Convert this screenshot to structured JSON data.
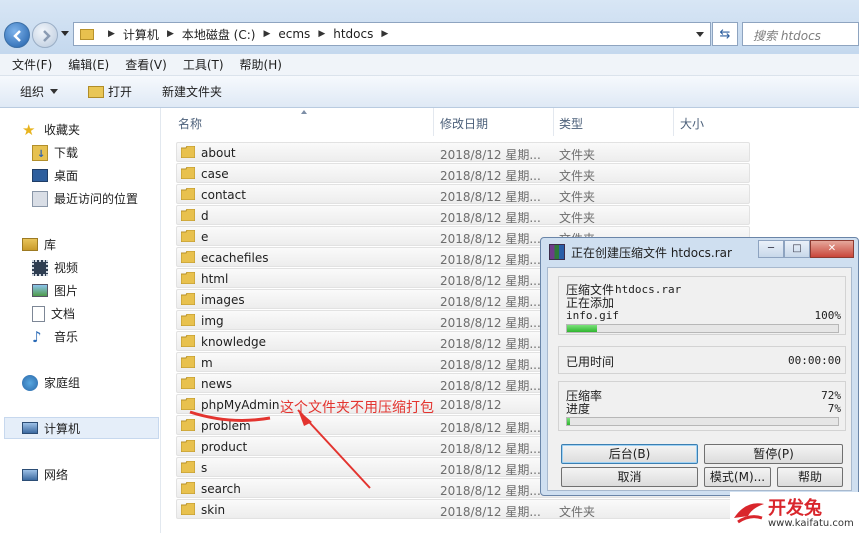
{
  "address": {
    "crumbs": [
      "计算机",
      "本地磁盘 (C:)",
      "ecms",
      "htdocs"
    ],
    "search_placeholder": "搜索 htdocs"
  },
  "menu": [
    "文件(F)",
    "编辑(E)",
    "查看(V)",
    "工具(T)",
    "帮助(H)"
  ],
  "toolbar": {
    "organize": "组织",
    "open": "打开",
    "new_folder": "新建文件夹"
  },
  "nav": {
    "favorites": "收藏夹",
    "downloads": "下载",
    "desktop": "桌面",
    "recent": "最近访问的位置",
    "libraries": "库",
    "videos": "视频",
    "pictures": "图片",
    "documents": "文档",
    "music": "音乐",
    "homegroup": "家庭组",
    "computer": "计算机",
    "network": "网络"
  },
  "columns": {
    "name": "名称",
    "date": "修改日期",
    "type": "类型",
    "size": "大小"
  },
  "files": [
    {
      "name": "about",
      "date": "2018/8/12 星期...",
      "type": "文件夹"
    },
    {
      "name": "case",
      "date": "2018/8/12 星期...",
      "type": "文件夹"
    },
    {
      "name": "contact",
      "date": "2018/8/12 星期...",
      "type": "文件夹"
    },
    {
      "name": "d",
      "date": "2018/8/12 星期...",
      "type": "文件夹"
    },
    {
      "name": "e",
      "date": "2018/8/12 星期...",
      "type": "文件夹"
    },
    {
      "name": "ecachefiles",
      "date": "2018/8/12 星期...",
      "type": ""
    },
    {
      "name": "html",
      "date": "2018/8/12 星期...",
      "type": ""
    },
    {
      "name": "images",
      "date": "2018/8/12 星期...",
      "type": ""
    },
    {
      "name": "img",
      "date": "2018/8/12 星期...",
      "type": ""
    },
    {
      "name": "knowledge",
      "date": "2018/8/12 星期...",
      "type": ""
    },
    {
      "name": "m",
      "date": "2018/8/12 星期...",
      "type": ""
    },
    {
      "name": "news",
      "date": "2018/8/12 星期...",
      "type": ""
    },
    {
      "name": "phpMyAdmin",
      "date": "2018/8/12",
      "type": ""
    },
    {
      "name": "problem",
      "date": "2018/8/12 星期...",
      "type": ""
    },
    {
      "name": "product",
      "date": "2018/8/12 星期...",
      "type": ""
    },
    {
      "name": "s",
      "date": "2018/8/12 星期...",
      "type": ""
    },
    {
      "name": "search",
      "date": "2018/8/12 星期...",
      "type": ""
    },
    {
      "name": "skin",
      "date": "2018/8/12 星期...",
      "type": "文件夹"
    }
  ],
  "annotation": "这个文件夹不用压缩打包",
  "dialog": {
    "title": "正在创建压缩文件 htdocs.rar",
    "compress_label": "压缩文件",
    "archive_name": "htdocs.rar",
    "adding_label": "正在添加",
    "current_file": "info.gif",
    "file_percent": "100%",
    "file_progress": 0.11,
    "elapsed_label": "已用时间",
    "elapsed_value": "00:00:00",
    "ratio_label": "压缩率",
    "ratio_value": "72%",
    "progress_label": "进度",
    "progress_value": "7%",
    "overall_progress": 0.01,
    "btn_background": "后台(B)",
    "btn_pause": "暂停(P)",
    "btn_cancel": "取消",
    "btn_mode": "模式(M)...",
    "btn_help": "帮助"
  },
  "watermark": {
    "brand": "开发兔",
    "url": "www.kaifatu.com"
  },
  "colors": {
    "annotation": "#e3342f",
    "progress_green": "#2fb52f",
    "folder": "#e8c14e"
  }
}
